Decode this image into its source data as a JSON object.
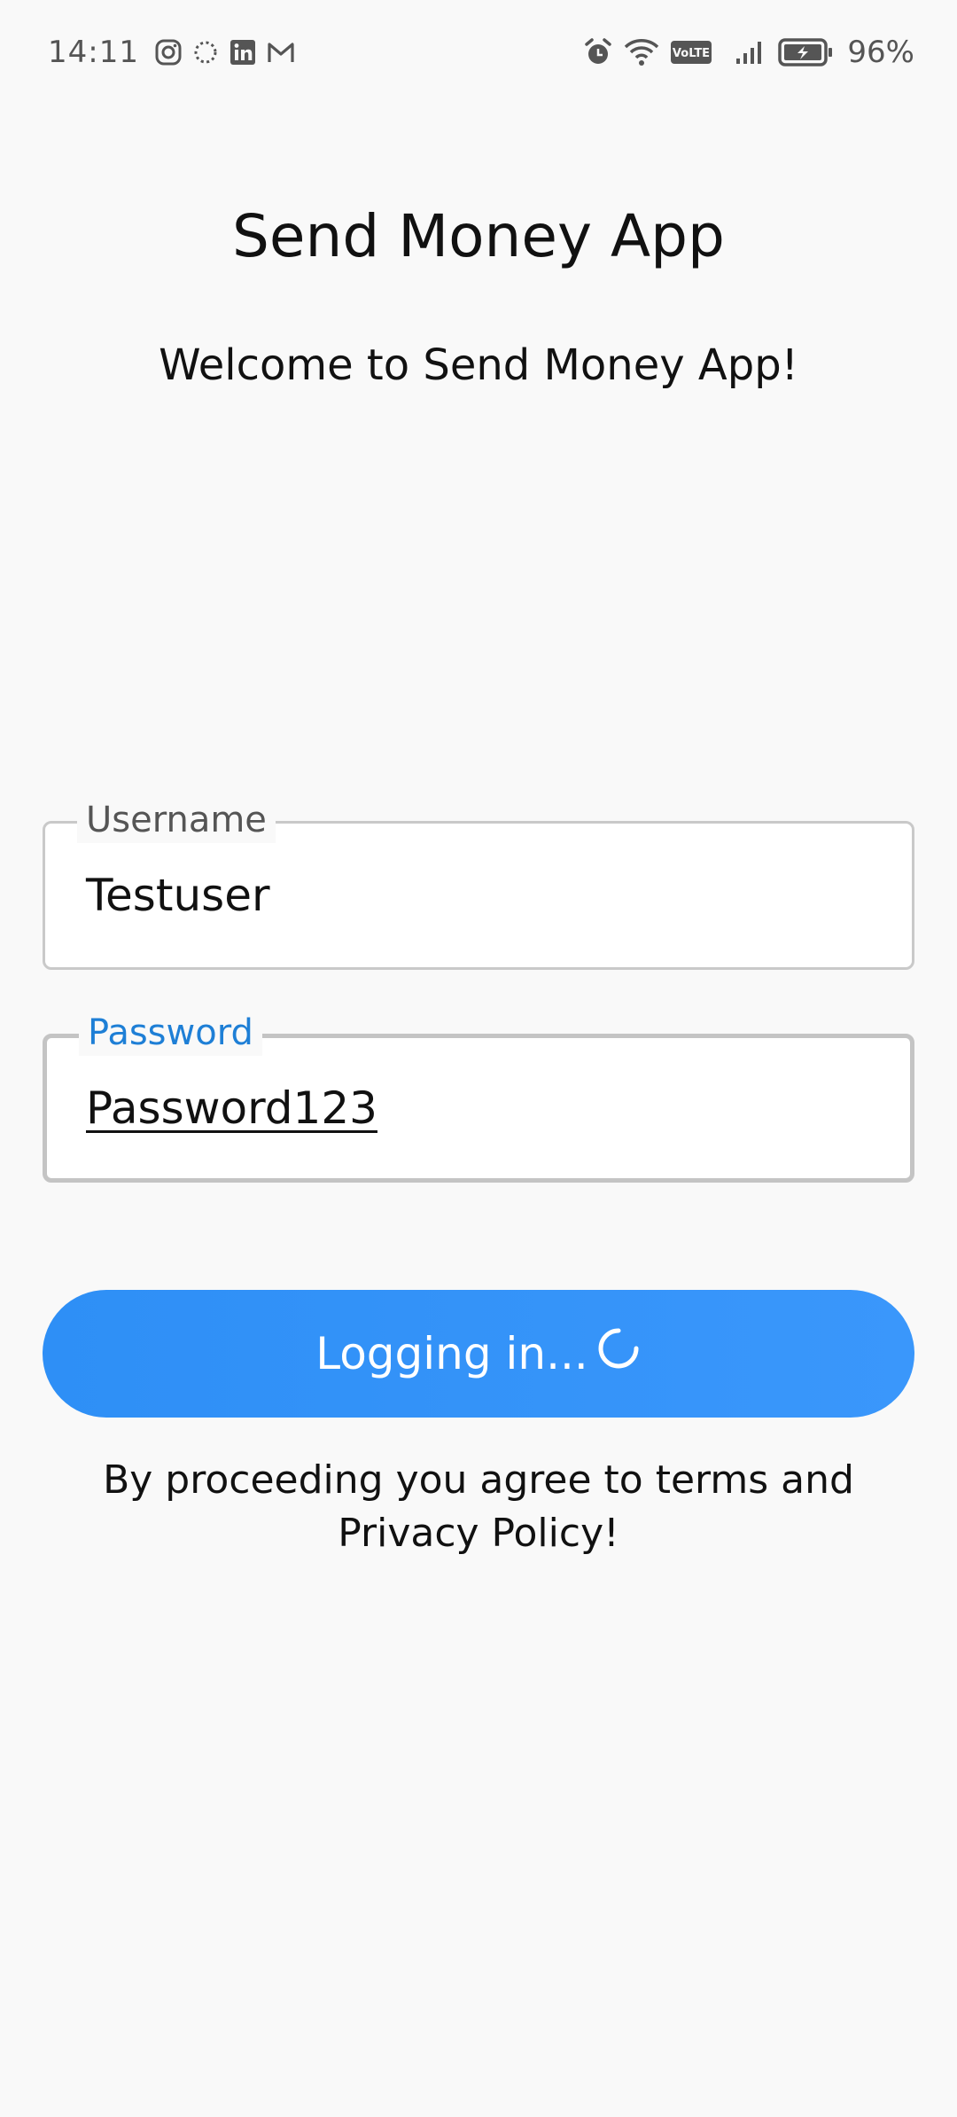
{
  "status_bar": {
    "time": "14:11",
    "battery": "96%"
  },
  "header": {
    "title": "Send Money App",
    "welcome": "Welcome to Send Money App!"
  },
  "form": {
    "username_label": "Username",
    "username_value": "Testuser",
    "password_label": "Password",
    "password_value": "Password123"
  },
  "login_button": {
    "label": "Logging in..."
  },
  "footer": {
    "terms": "By proceeding you agree to terms and Privacy Policy!"
  },
  "colors": {
    "accent": "#1e7fd6",
    "button": "#3592f8",
    "background": "#f9f9f9"
  },
  "icons": [
    "instagram-icon",
    "loading-circle-icon",
    "linkedin-icon",
    "gmail-icon",
    "alarm-icon",
    "wifi-icon",
    "volte-icon",
    "signal-icon",
    "battery-icon",
    "spinner-icon"
  ]
}
